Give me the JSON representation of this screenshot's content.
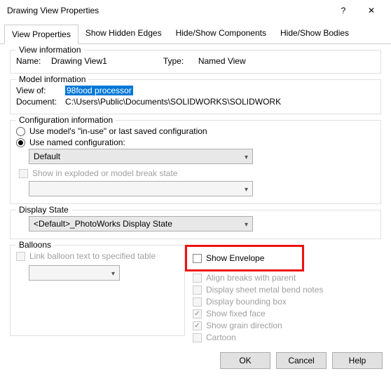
{
  "window": {
    "title": "Drawing View Properties",
    "help_symbol": "?",
    "close_symbol": "✕"
  },
  "tabs": {
    "t0": "View Properties",
    "t1": "Show Hidden Edges",
    "t2": "Hide/Show Components",
    "t3": "Hide/Show Bodies"
  },
  "view_info": {
    "group_label": "View information",
    "name_label": "Name:",
    "name_value": "Drawing View1",
    "type_label": "Type:",
    "type_value": "Named View"
  },
  "model_info": {
    "group_label": "Model information",
    "view_of_label": "View of:",
    "view_of_value": "98food processor",
    "document_label": "Document:",
    "document_value": "C:\\Users\\Public\\Documents\\SOLIDWORKS\\SOLIDWORK"
  },
  "config_info": {
    "group_label": "Configuration information",
    "radio_inuse": "Use model's \"in-use\" or last saved configuration",
    "radio_named": "Use named configuration:",
    "combo_value": "Default",
    "show_exploded": "Show in exploded or model break state"
  },
  "display_state": {
    "group_label": "Display State",
    "combo_value": "<Default>_PhotoWorks Display State"
  },
  "balloons": {
    "group_label": "Balloons",
    "link_text": "Link balloon text to specified table"
  },
  "right_opts": {
    "show_envelope": "Show Envelope",
    "align_breaks": "Align breaks with parent",
    "display_sheet": "Display sheet metal bend notes",
    "display_bbox": "Display bounding box",
    "show_fixed": "Show fixed face",
    "show_grain": "Show grain direction",
    "cartoon": "Cartoon"
  },
  "buttons": {
    "ok": "OK",
    "cancel": "Cancel",
    "help": "Help"
  }
}
